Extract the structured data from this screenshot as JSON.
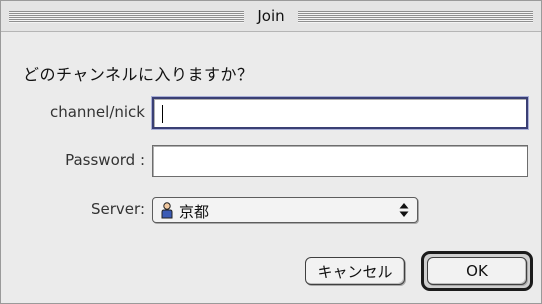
{
  "window": {
    "title": "Join"
  },
  "prompt": "どのチャンネルに入りますか？",
  "fields": {
    "channel_label": "channel/nick",
    "channel_value": "",
    "password_label": "Password :",
    "password_value": "",
    "server_label": "Server:",
    "server_value": "京都",
    "server_icon": "user-icon"
  },
  "buttons": {
    "cancel": "キャンセル",
    "ok": "OK"
  }
}
